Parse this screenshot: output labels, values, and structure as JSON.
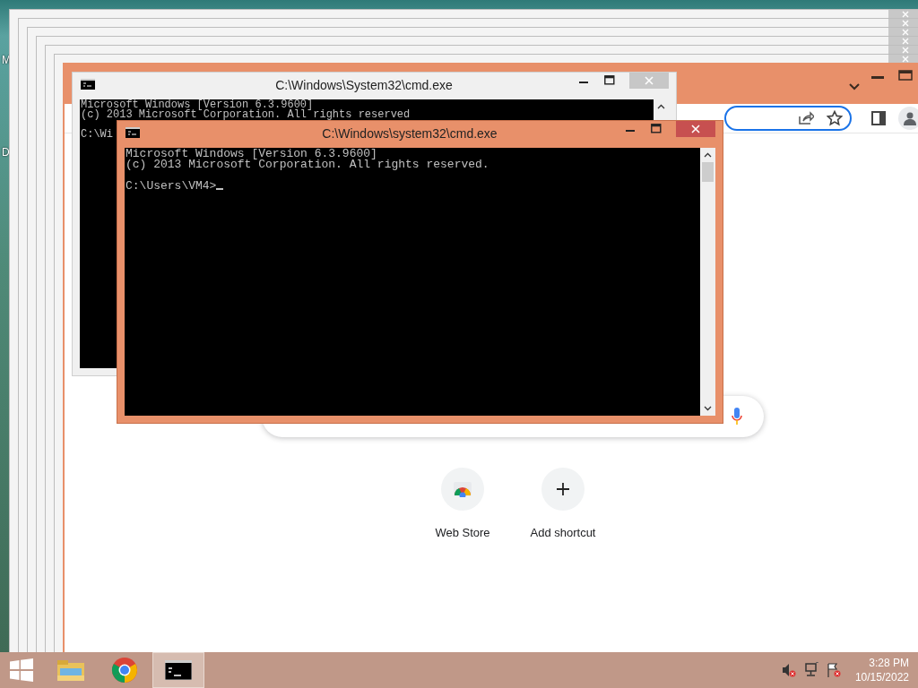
{
  "desktop": {
    "icon_labels": [
      "M",
      "D"
    ]
  },
  "browser": {
    "shortcuts": [
      {
        "kind": "webstore",
        "label": "Web Store"
      },
      {
        "kind": "add",
        "label": "Add shortcut"
      }
    ]
  },
  "console_windows": [
    {
      "title": "C:\\Windows\\System32\\cmd.exe",
      "active": false,
      "lines": [
        "Microsoft Windows [Version 6.3.9600]",
        "(c) 2013 Microsoft Corporation. All rights reserved"
      ],
      "prompt": "C:\\Wi",
      "cursor": false
    },
    {
      "title": "C:\\Windows\\system32\\cmd.exe",
      "active": true,
      "lines": [
        "Microsoft Windows [Version 6.3.9600]",
        "(c) 2013 Microsoft Corporation. All rights reserved."
      ],
      "prompt": "C:\\Users\\VM4>",
      "cursor": true
    }
  ],
  "taskbar": {
    "items": [
      {
        "kind": "explorer",
        "active": false
      },
      {
        "kind": "chrome",
        "active": false
      },
      {
        "kind": "cmd",
        "active": true
      }
    ],
    "time": "3:28 PM",
    "date": "10/15/2022"
  }
}
